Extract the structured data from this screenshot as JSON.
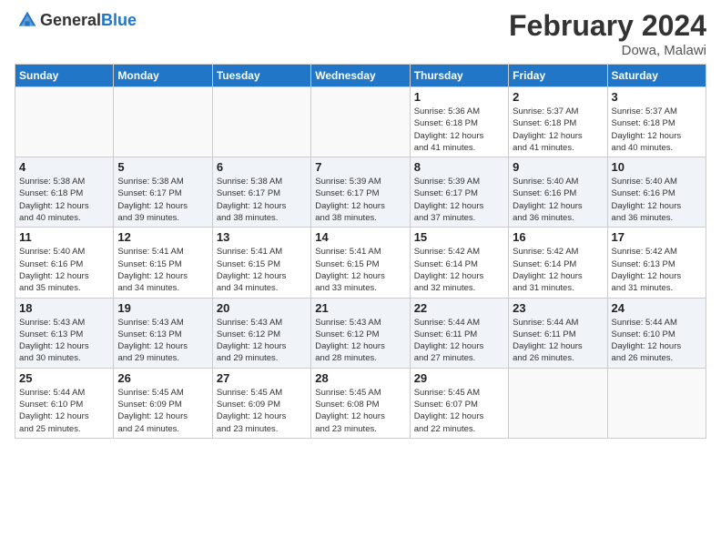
{
  "header": {
    "logo_general": "General",
    "logo_blue": "Blue",
    "month_year": "February 2024",
    "location": "Dowa, Malawi"
  },
  "weekdays": [
    "Sunday",
    "Monday",
    "Tuesday",
    "Wednesday",
    "Thursday",
    "Friday",
    "Saturday"
  ],
  "weeks": [
    [
      {
        "day": "",
        "info": ""
      },
      {
        "day": "",
        "info": ""
      },
      {
        "day": "",
        "info": ""
      },
      {
        "day": "",
        "info": ""
      },
      {
        "day": "1",
        "info": "Sunrise: 5:36 AM\nSunset: 6:18 PM\nDaylight: 12 hours\nand 41 minutes."
      },
      {
        "day": "2",
        "info": "Sunrise: 5:37 AM\nSunset: 6:18 PM\nDaylight: 12 hours\nand 41 minutes."
      },
      {
        "day": "3",
        "info": "Sunrise: 5:37 AM\nSunset: 6:18 PM\nDaylight: 12 hours\nand 40 minutes."
      }
    ],
    [
      {
        "day": "4",
        "info": "Sunrise: 5:38 AM\nSunset: 6:18 PM\nDaylight: 12 hours\nand 40 minutes."
      },
      {
        "day": "5",
        "info": "Sunrise: 5:38 AM\nSunset: 6:17 PM\nDaylight: 12 hours\nand 39 minutes."
      },
      {
        "day": "6",
        "info": "Sunrise: 5:38 AM\nSunset: 6:17 PM\nDaylight: 12 hours\nand 38 minutes."
      },
      {
        "day": "7",
        "info": "Sunrise: 5:39 AM\nSunset: 6:17 PM\nDaylight: 12 hours\nand 38 minutes."
      },
      {
        "day": "8",
        "info": "Sunrise: 5:39 AM\nSunset: 6:17 PM\nDaylight: 12 hours\nand 37 minutes."
      },
      {
        "day": "9",
        "info": "Sunrise: 5:40 AM\nSunset: 6:16 PM\nDaylight: 12 hours\nand 36 minutes."
      },
      {
        "day": "10",
        "info": "Sunrise: 5:40 AM\nSunset: 6:16 PM\nDaylight: 12 hours\nand 36 minutes."
      }
    ],
    [
      {
        "day": "11",
        "info": "Sunrise: 5:40 AM\nSunset: 6:16 PM\nDaylight: 12 hours\nand 35 minutes."
      },
      {
        "day": "12",
        "info": "Sunrise: 5:41 AM\nSunset: 6:15 PM\nDaylight: 12 hours\nand 34 minutes."
      },
      {
        "day": "13",
        "info": "Sunrise: 5:41 AM\nSunset: 6:15 PM\nDaylight: 12 hours\nand 34 minutes."
      },
      {
        "day": "14",
        "info": "Sunrise: 5:41 AM\nSunset: 6:15 PM\nDaylight: 12 hours\nand 33 minutes."
      },
      {
        "day": "15",
        "info": "Sunrise: 5:42 AM\nSunset: 6:14 PM\nDaylight: 12 hours\nand 32 minutes."
      },
      {
        "day": "16",
        "info": "Sunrise: 5:42 AM\nSunset: 6:14 PM\nDaylight: 12 hours\nand 31 minutes."
      },
      {
        "day": "17",
        "info": "Sunrise: 5:42 AM\nSunset: 6:13 PM\nDaylight: 12 hours\nand 31 minutes."
      }
    ],
    [
      {
        "day": "18",
        "info": "Sunrise: 5:43 AM\nSunset: 6:13 PM\nDaylight: 12 hours\nand 30 minutes."
      },
      {
        "day": "19",
        "info": "Sunrise: 5:43 AM\nSunset: 6:13 PM\nDaylight: 12 hours\nand 29 minutes."
      },
      {
        "day": "20",
        "info": "Sunrise: 5:43 AM\nSunset: 6:12 PM\nDaylight: 12 hours\nand 29 minutes."
      },
      {
        "day": "21",
        "info": "Sunrise: 5:43 AM\nSunset: 6:12 PM\nDaylight: 12 hours\nand 28 minutes."
      },
      {
        "day": "22",
        "info": "Sunrise: 5:44 AM\nSunset: 6:11 PM\nDaylight: 12 hours\nand 27 minutes."
      },
      {
        "day": "23",
        "info": "Sunrise: 5:44 AM\nSunset: 6:11 PM\nDaylight: 12 hours\nand 26 minutes."
      },
      {
        "day": "24",
        "info": "Sunrise: 5:44 AM\nSunset: 6:10 PM\nDaylight: 12 hours\nand 26 minutes."
      }
    ],
    [
      {
        "day": "25",
        "info": "Sunrise: 5:44 AM\nSunset: 6:10 PM\nDaylight: 12 hours\nand 25 minutes."
      },
      {
        "day": "26",
        "info": "Sunrise: 5:45 AM\nSunset: 6:09 PM\nDaylight: 12 hours\nand 24 minutes."
      },
      {
        "day": "27",
        "info": "Sunrise: 5:45 AM\nSunset: 6:09 PM\nDaylight: 12 hours\nand 23 minutes."
      },
      {
        "day": "28",
        "info": "Sunrise: 5:45 AM\nSunset: 6:08 PM\nDaylight: 12 hours\nand 23 minutes."
      },
      {
        "day": "29",
        "info": "Sunrise: 5:45 AM\nSunset: 6:07 PM\nDaylight: 12 hours\nand 22 minutes."
      },
      {
        "day": "",
        "info": ""
      },
      {
        "day": "",
        "info": ""
      }
    ]
  ]
}
